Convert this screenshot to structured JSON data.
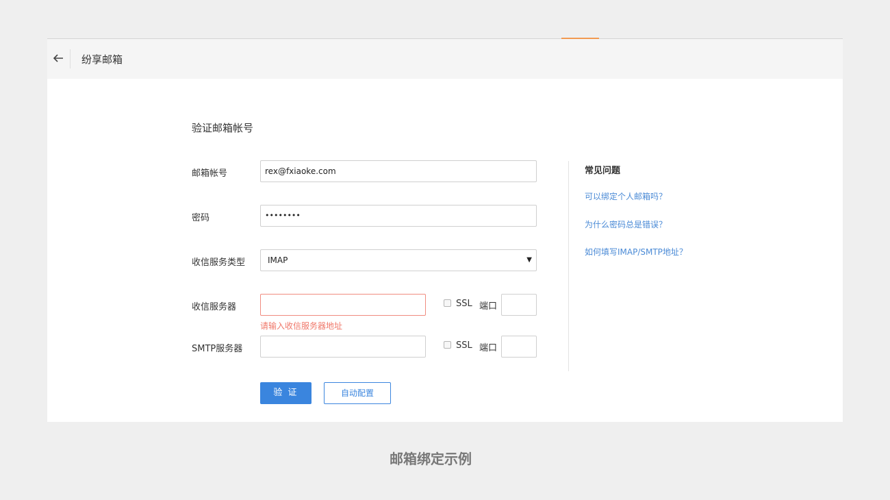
{
  "header": {
    "title": "纷享邮箱"
  },
  "form": {
    "section_title": "验证邮箱帐号",
    "email_label": "邮箱帐号",
    "email_value": "rex@fxiaoke.com",
    "password_label": "密码",
    "password_value": "••••••••",
    "type_label": "收信服务类型",
    "type_value": "IMAP",
    "incoming_label": "收信服务器",
    "incoming_value": "",
    "incoming_error": "请输入收信服务器地址",
    "smtp_label": "SMTP服务器",
    "smtp_value": "",
    "ssl_label": "SSL",
    "port_label": "端口",
    "verify_button": "验 证",
    "auto_config_button": "自动配置"
  },
  "faq": {
    "title": "常见问题",
    "items": [
      "可以绑定个人邮箱吗？",
      "为什么密码总是错误？",
      "如何填写IMAP/SMTP地址？"
    ]
  },
  "caption": "邮箱绑定示例",
  "colors": {
    "accent": "#3a85de",
    "error": "#f0786a",
    "tab_accent": "#f29a51"
  },
  "icons": {
    "back": "arrow-left-icon",
    "dropdown": "caret-down-icon"
  }
}
